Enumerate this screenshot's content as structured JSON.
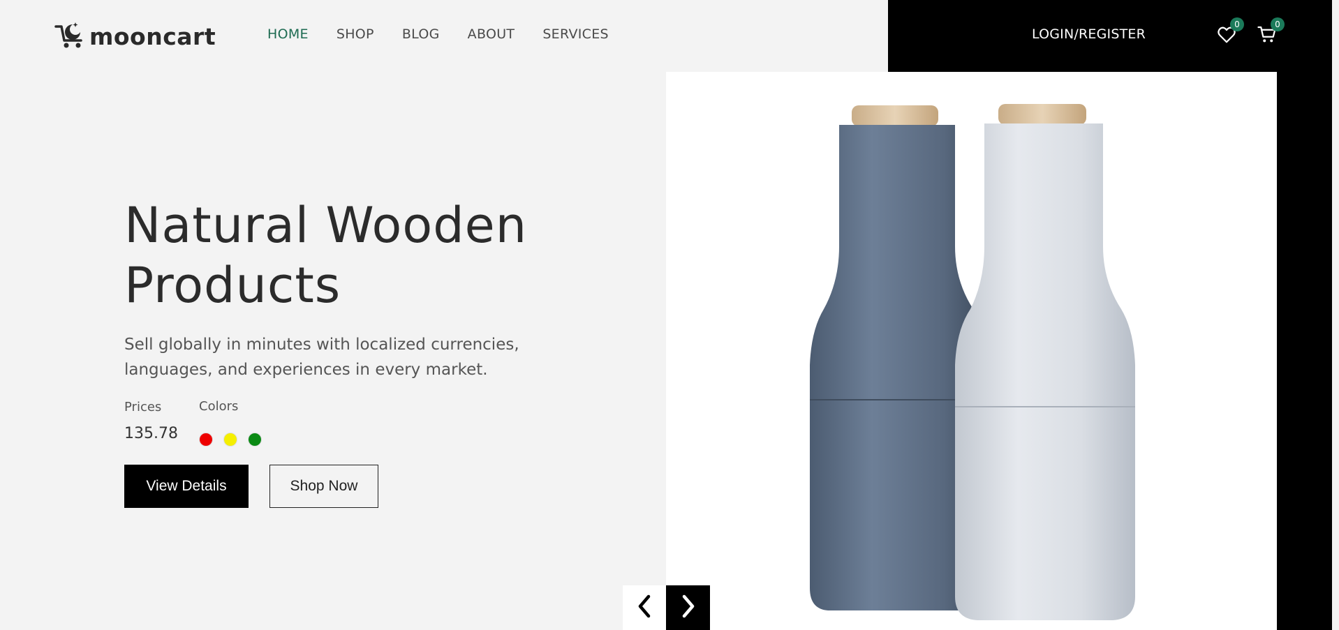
{
  "brand": {
    "name": "mooncart",
    "logo_icon": "cart-moon-icon"
  },
  "nav": {
    "items": [
      {
        "label": "HOME",
        "active": true
      },
      {
        "label": "SHOP",
        "active": false
      },
      {
        "label": "BLOG",
        "active": false
      },
      {
        "label": "ABOUT",
        "active": false
      },
      {
        "label": "SERVICES",
        "active": false
      }
    ]
  },
  "header": {
    "login_label": "LOGIN/REGISTER",
    "wishlist": {
      "icon": "heart-icon",
      "count": "0"
    },
    "cart": {
      "icon": "cart-icon",
      "count": "0"
    }
  },
  "hero": {
    "title": "Natural Wooden Products",
    "subtitle": "Sell globally in minutes with localized currencies, languages, and experiences in every market.",
    "prices_label": "Prices",
    "colors_label": "Colors",
    "price": "135.78",
    "colors": [
      "#ee0000",
      "#f5ef00",
      "#0a8a14"
    ],
    "view_details_label": "View Details",
    "shop_now_label": "Shop Now"
  },
  "slider": {
    "prev_icon": "chevron-left-icon",
    "next_icon": "chevron-right-icon"
  },
  "theme": {
    "accent": "#1e6b52",
    "badge": "#1b7a5a",
    "background": "#f3f3f3"
  }
}
